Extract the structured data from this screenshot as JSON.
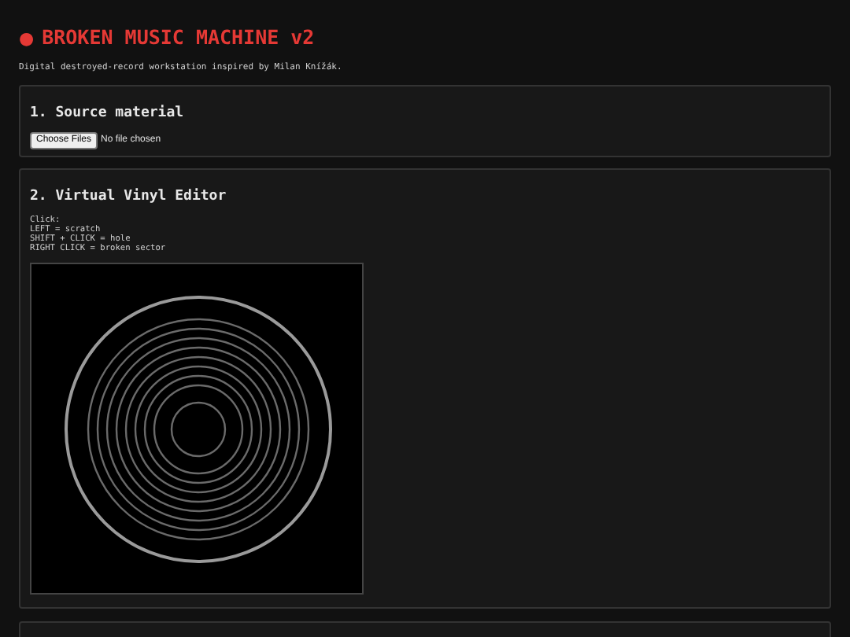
{
  "header": {
    "icon": "●",
    "title": "BROKEN MUSIC MACHINE v2",
    "subtitle": "Digital destroyed-record workstation inspired by Milan Knížák."
  },
  "sections": [
    {
      "kind": "file",
      "heading": "1. Source material",
      "button": "Choose Files",
      "status": "No file chosen"
    },
    {
      "kind": "editor",
      "heading": "2. Virtual Vinyl Editor",
      "instructions": [
        "Click:",
        "LEFT = scratch",
        "SHIFT + CLICK = hole",
        "RIGHT CLICK = broken sector"
      ]
    },
    {
      "kind": "empty"
    }
  ]
}
